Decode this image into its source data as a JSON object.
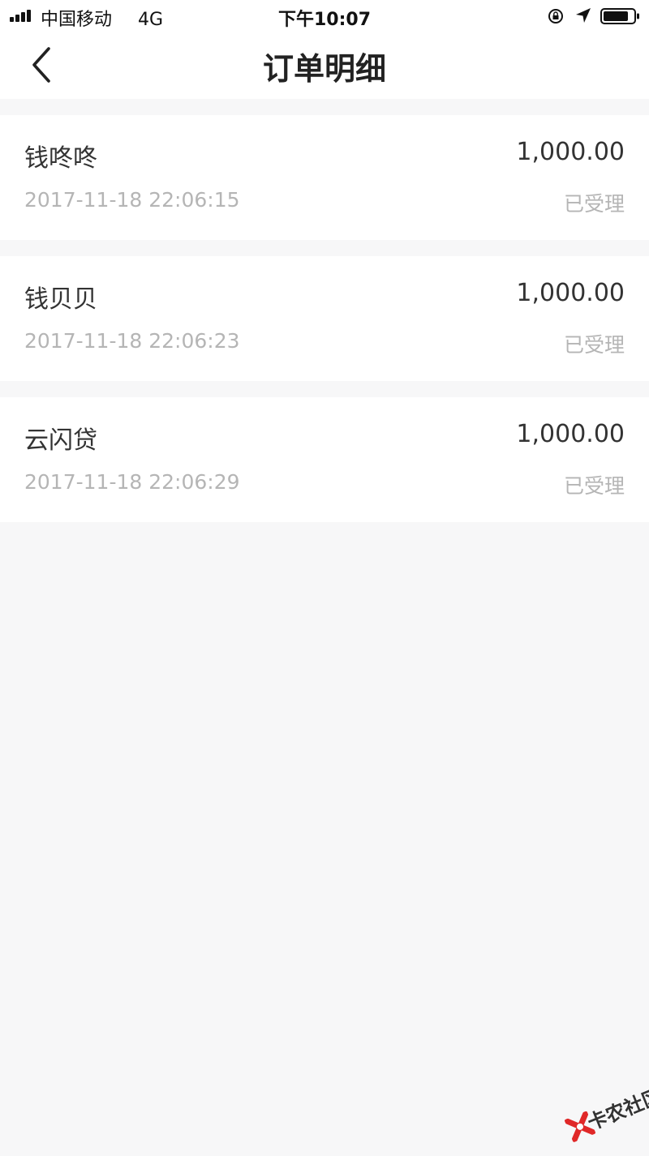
{
  "status_bar": {
    "carrier": "中国移动",
    "network": "4G",
    "time": "下午10:07",
    "icons": [
      "signal-icon",
      "rotation-lock-icon",
      "location-arrow-icon",
      "battery-icon"
    ]
  },
  "nav": {
    "title": "订单明细",
    "back_icon": "chevron-left-icon"
  },
  "orders": [
    {
      "name": "钱咚咚",
      "amount": "1,000.00",
      "time": "2017-11-18 22:06:15",
      "status": "已受理"
    },
    {
      "name": "钱贝贝",
      "amount": "1,000.00",
      "time": "2017-11-18 22:06:23",
      "status": "已受理"
    },
    {
      "name": "云闪贷",
      "amount": "1,000.00",
      "time": "2017-11-18 22:06:29",
      "status": "已受理"
    }
  ],
  "watermark": {
    "text": "卡农社区",
    "logo_color": "#e02828"
  },
  "colors": {
    "page_background": "#f7f7f8",
    "card_background": "#ffffff",
    "primary_text": "#333333",
    "secondary_text": "#b5b5b5"
  }
}
